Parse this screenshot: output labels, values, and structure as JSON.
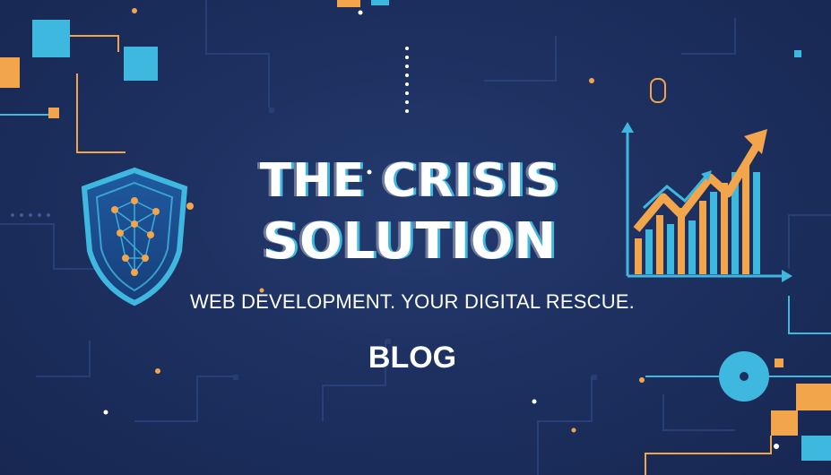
{
  "banner": {
    "title_line1": "THE CRISIS",
    "title_line2": "SOLUTION",
    "tagline": "WEB DEVELOPMENT. YOUR DIGITAL RESCUE.",
    "blog_label": "BLOG"
  },
  "colors": {
    "background": "#1c2f5c",
    "accent_cyan": "#3fb8e0",
    "accent_orange": "#f2a54a",
    "text": "#ffffff"
  },
  "icons": {
    "shield": "shield-network-icon",
    "chart": "growth-chart-icon"
  }
}
